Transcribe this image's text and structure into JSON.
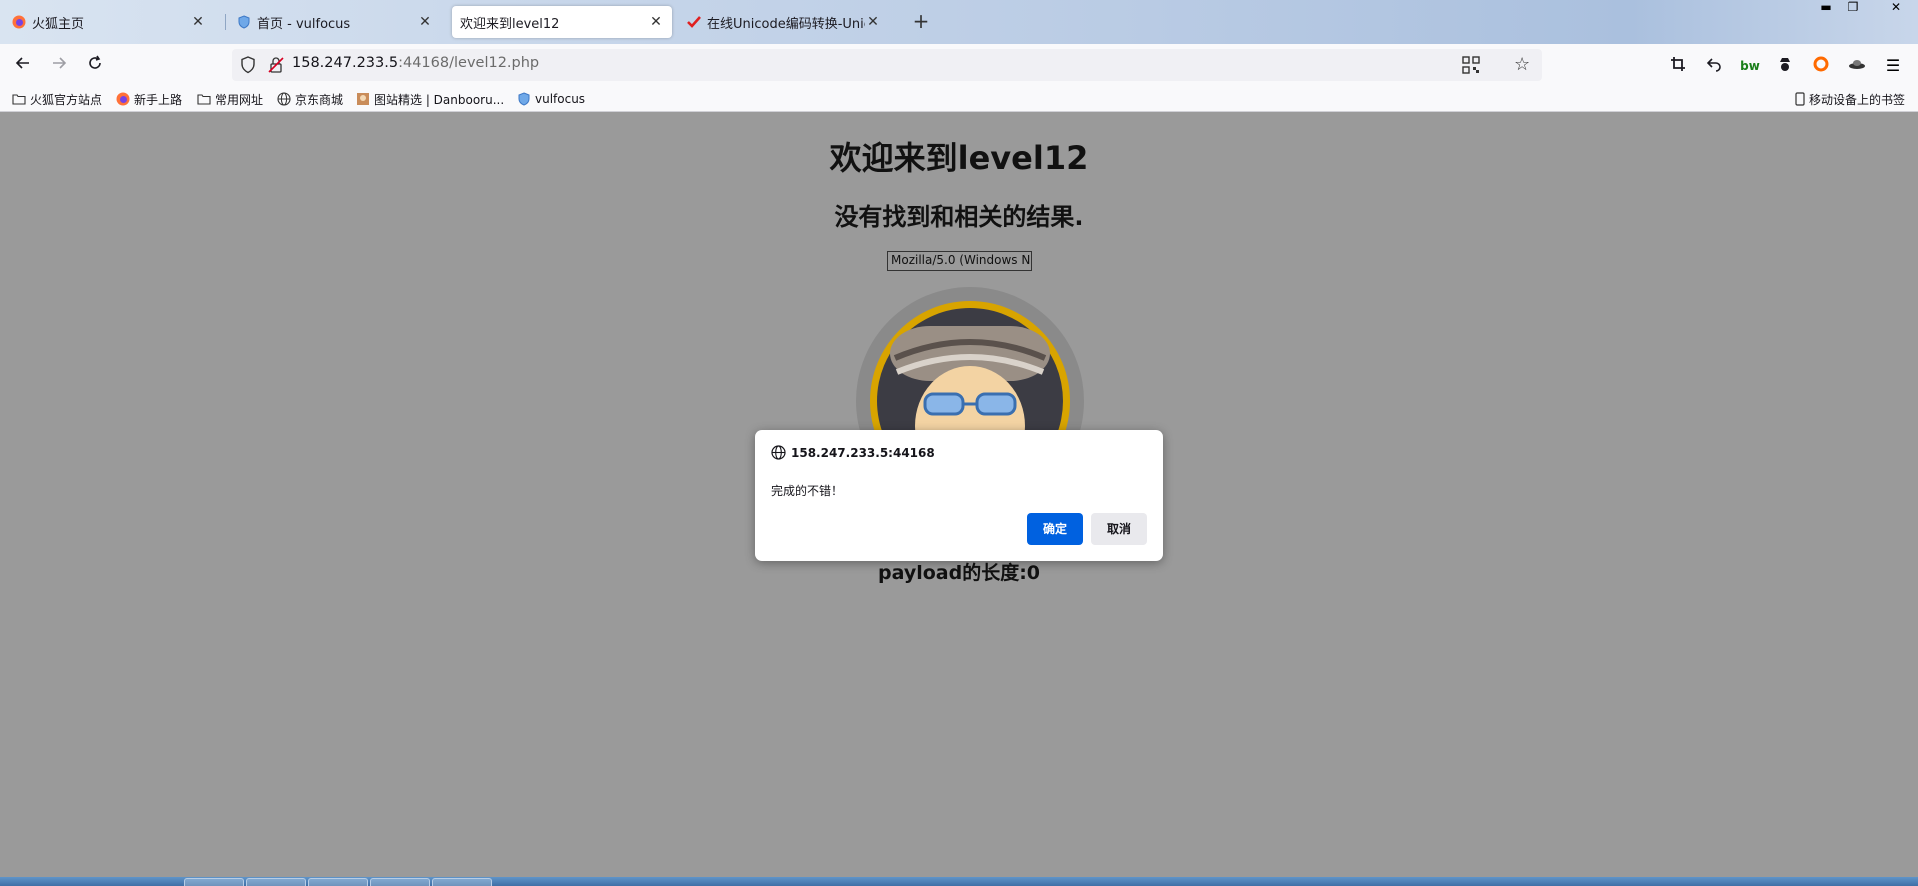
{
  "browser": {
    "tabs": [
      {
        "title": "火狐主页",
        "active": false,
        "closable": false
      },
      {
        "title": "首页 - vulfocus",
        "active": false,
        "closable": true
      },
      {
        "title": "欢迎来到level12",
        "active": true,
        "closable": true
      },
      {
        "title": "在线Unicode编码转换-Unicod",
        "active": false,
        "closable": true
      }
    ],
    "new_tab_label": "+",
    "window_buttons": {
      "minimize": "▬",
      "restore": "❐",
      "close": "✕"
    },
    "url": {
      "host": "158.247.233.5",
      "rest": ":44168/level12.php"
    },
    "bookmarks": [
      {
        "label": "火狐官方站点",
        "icon": "folder-icon"
      },
      {
        "label": "新手上路",
        "icon": "firefox-icon"
      },
      {
        "label": "常用网址",
        "icon": "folder-icon"
      },
      {
        "label": "京东商城",
        "icon": "globe-icon"
      },
      {
        "label": "图站精选 | Danbooru...",
        "icon": "image-icon"
      },
      {
        "label": "vulfocus",
        "icon": "shield-icon"
      }
    ],
    "mobile_bookmarks_label": "移动设备上的书签",
    "accent_color": "#0061e0"
  },
  "page": {
    "heading": "欢迎来到level12",
    "subheading": "没有找到和相关的结果.",
    "ua_input_value": "Mozilla/5.0 (Windows N",
    "payload_length": "payload的长度:0"
  },
  "dialog": {
    "origin": "158.247.233.5:44168",
    "message": "完成的不错！",
    "ok_label": "确定",
    "cancel_label": "取消"
  }
}
